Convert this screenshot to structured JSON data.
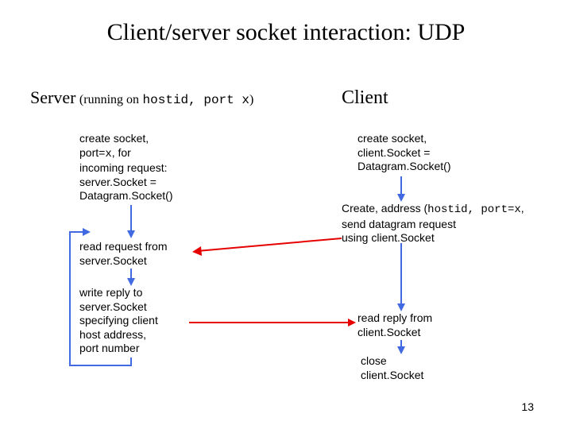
{
  "title": "Client/server socket interaction: UDP",
  "server": {
    "h": "Server",
    "sub_pre": "(running on",
    "sub_code": "hostid, port x",
    "sub_post": ")"
  },
  "client_h": "Client",
  "s1": {
    "l1": "create socket,",
    "l2_pre": "port=",
    "l2_code": "x",
    "l2_post": ", for",
    "l3": "incoming request:",
    "l4": "server.Socket =",
    "l5": "Datagram.Socket()"
  },
  "s2": {
    "l1": "read request from",
    "l2": "server.Socket"
  },
  "s3": {
    "l1": "write reply to",
    "l2": "server.Socket",
    "l3": "specifying client",
    "l4": "host address,",
    "l5": "port number"
  },
  "c1": {
    "l1": "create socket,",
    "l2": "client.Socket =",
    "l3": "Datagram.Socket()"
  },
  "c2": {
    "l1_pre": "Create, address (",
    "l1_code": "hostid, port=x",
    "l1_post": ",",
    "l2": "send datagram request",
    "l3": "using client.Socket"
  },
  "c3": {
    "l1": "read reply from",
    "l2": "client.Socket"
  },
  "c4": {
    "l1": "close",
    "l2": "client.Socket"
  },
  "pagenum": "13"
}
